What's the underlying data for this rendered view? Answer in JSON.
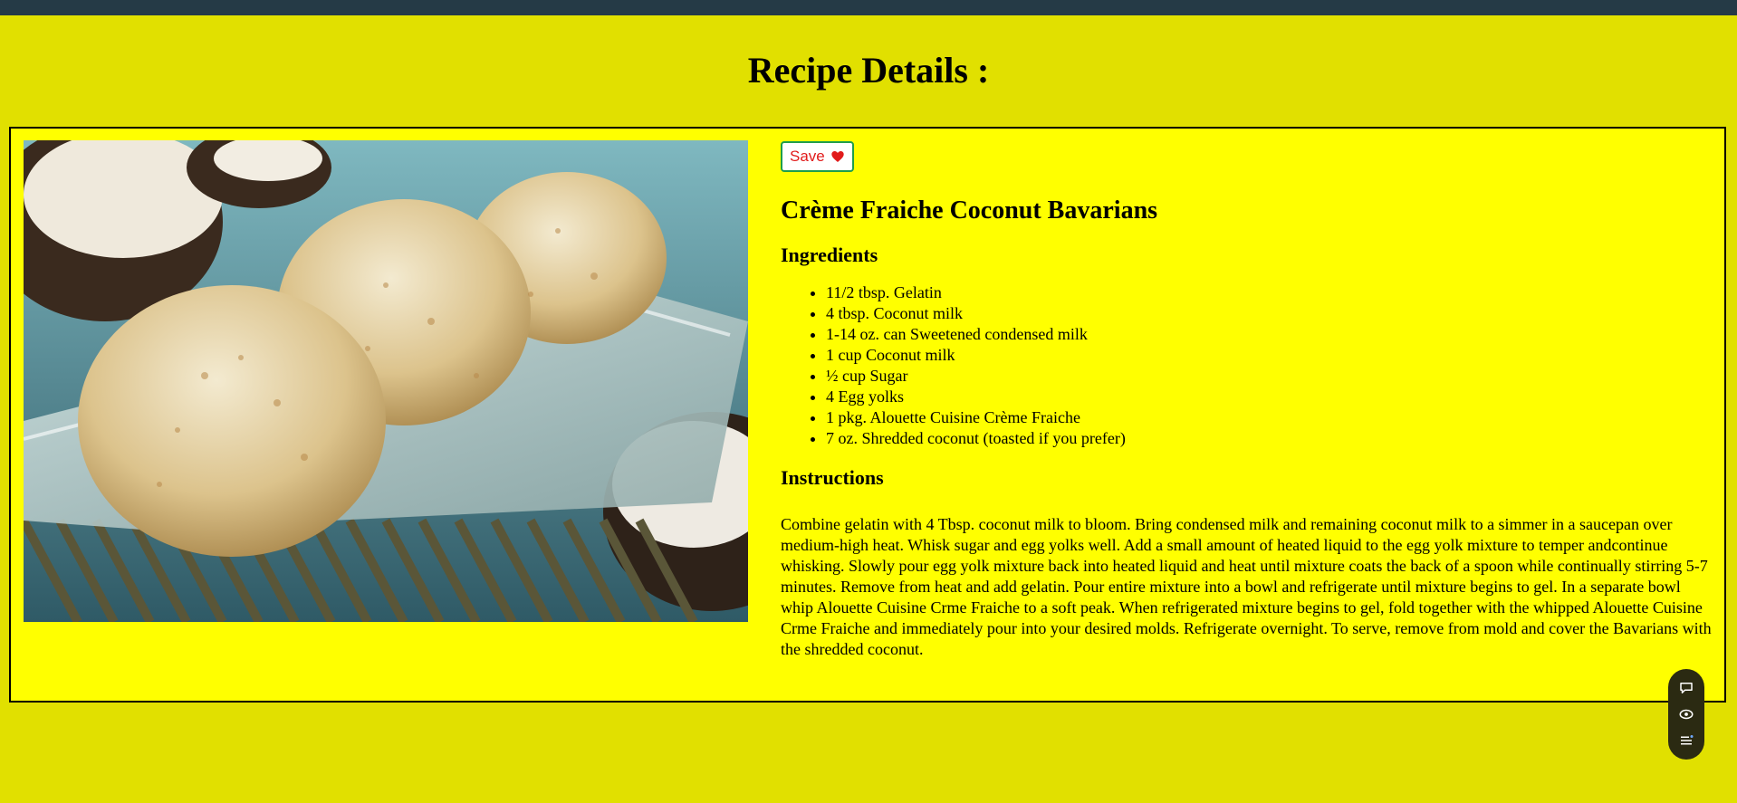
{
  "page": {
    "title": "Recipe Details :"
  },
  "recipe": {
    "save_label": "Save",
    "save_icon": "heart-icon",
    "name": "Crème Fraiche Coconut Bavarians",
    "ingredients_heading": "Ingredients",
    "ingredients": [
      "11/2 tbsp. Gelatin",
      "4 tbsp. Coconut milk",
      "1-14 oz. can Sweetened condensed milk",
      "1 cup Coconut milk",
      "½ cup Sugar",
      "4 Egg yolks",
      "1 pkg. Alouette Cuisine Crème Fraiche",
      "7 oz. Shredded coconut (toasted if you prefer)"
    ],
    "instructions_heading": "Instructions",
    "instructions": "Combine gelatin with 4 Tbsp. coconut milk to bloom. Bring condensed milk and remaining coconut milk to a simmer in a saucepan over medium-high heat. Whisk sugar and egg yolks well. Add a small amount of heated liquid to the egg yolk mixture to temper andcontinue whisking. Slowly pour egg yolk mixture back into heated liquid and heat until mixture coats the back of a spoon while continually stirring 5-7 minutes. Remove from heat and add gelatin. Pour entire mixture into a bowl and refrigerate until mixture begins to gel. In a separate bowl whip Alouette Cuisine Crme Fraiche to a soft peak. When refrigerated mixture begins to gel, fold together with the whipped Alouette Cuisine Crme Fraiche and immediately pour into your desired molds. Refrigerate overnight. To serve, remove from mold and cover the Bavarians with the shredded coconut."
  },
  "toolbar": {
    "icons": [
      "chat-icon",
      "eye-icon",
      "list-icon"
    ]
  },
  "colors": {
    "page_background": "#e1e000",
    "card_background": "#ffff00",
    "topbar": "#253a46",
    "save_border": "#1f9e4b",
    "save_text": "#e11b1b",
    "toolbar_background": "#2b2a12"
  }
}
